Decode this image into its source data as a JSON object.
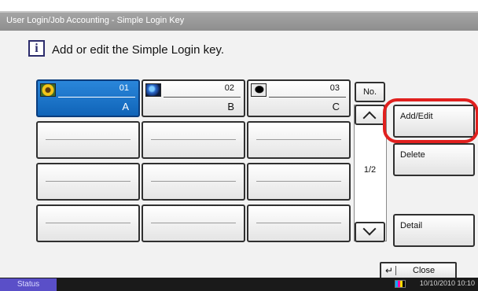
{
  "window": {
    "title": "User Login/Job Accounting - Simple Login Key"
  },
  "message": {
    "icon": "info-icon",
    "icon_glyph": "i",
    "text": "Add or edit the Simple Login key."
  },
  "keys": [
    {
      "number": "01",
      "name": "A",
      "thumb": "sunflower-icon",
      "selected": true
    },
    {
      "number": "02",
      "name": "B",
      "thumb": "globe-icon",
      "selected": false
    },
    {
      "number": "03",
      "name": "C",
      "thumb": "person-silhouette-icon",
      "selected": false
    },
    {
      "number": "",
      "name": ""
    },
    {
      "number": "",
      "name": ""
    },
    {
      "number": "",
      "name": ""
    },
    {
      "number": "",
      "name": ""
    },
    {
      "number": "",
      "name": ""
    },
    {
      "number": "",
      "name": ""
    },
    {
      "number": "",
      "name": ""
    },
    {
      "number": "",
      "name": ""
    },
    {
      "number": "",
      "name": ""
    }
  ],
  "sort": {
    "label": "No."
  },
  "pager": {
    "page": "1/2",
    "up_icon": "chevron-up-icon",
    "down_icon": "chevron-down-icon"
  },
  "actions": {
    "add_edit": "Add/Edit",
    "delete": "Delete",
    "detail": "Detail"
  },
  "footer": {
    "close_label": "Close",
    "close_icon": "enter-icon",
    "close_glyph": "↵"
  },
  "status_bar": {
    "status_label": "Status",
    "datetime": "10/10/2010  10:10",
    "toner_icon": "toner-icon"
  },
  "colors": {
    "selected": "#1a74c8",
    "highlight": "#e0201e",
    "status_button": "#5a4fc8"
  }
}
